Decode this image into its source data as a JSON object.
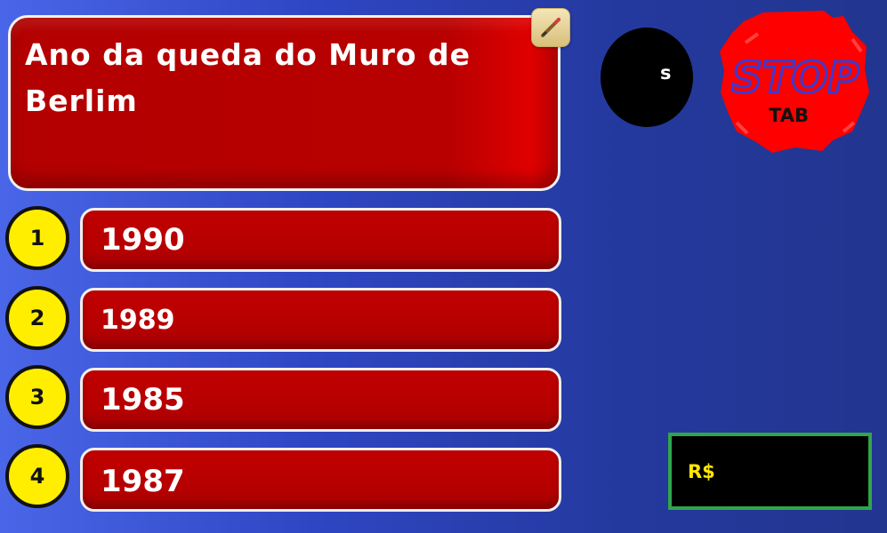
{
  "question": {
    "text": "Ano da queda do Muro de Berlim"
  },
  "answers": [
    {
      "number": "1",
      "label": "1990"
    },
    {
      "number": "2",
      "label": "1989"
    },
    {
      "number": "3",
      "label": "1985"
    },
    {
      "number": "4",
      "label": "1987"
    }
  ],
  "timer": {
    "unit_label": "s"
  },
  "stop_button": {
    "title": "STOP",
    "key_hint": "TAB"
  },
  "prize": {
    "currency_label": "R$"
  },
  "icons": {
    "edit": "pencil-icon"
  },
  "colors": {
    "background": "#2f46c4",
    "panel_red": "#b80000",
    "number_yellow": "#ffee00",
    "stop_red": "#ff0000",
    "prize_border": "#2ea64a",
    "prize_text": "#ffe600"
  }
}
